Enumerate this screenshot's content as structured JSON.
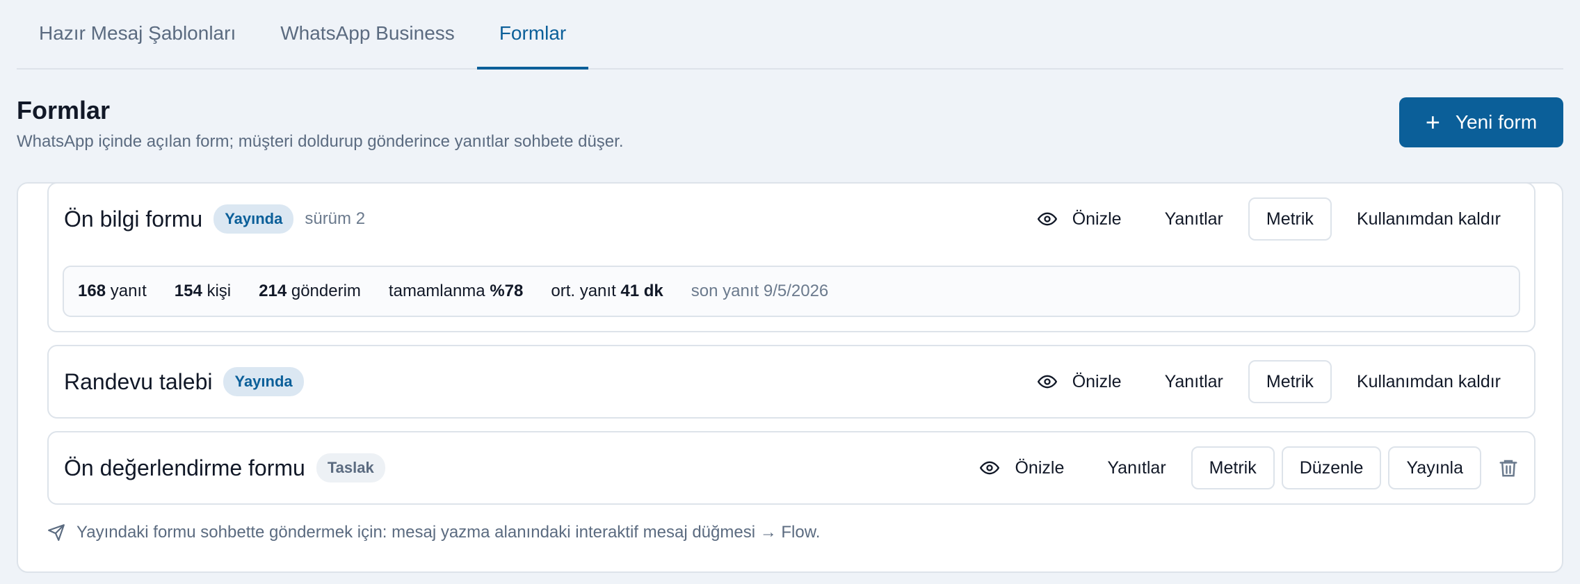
{
  "tabs": [
    {
      "label": "Hazır Mesaj Şablonları",
      "active": false
    },
    {
      "label": "WhatsApp Business",
      "active": false
    },
    {
      "label": "Formlar",
      "active": true
    }
  ],
  "header": {
    "title": "Formlar",
    "subtitle": "WhatsApp içinde açılan form; müşteri doldurup gönderince yanıtlar sohbete düşer.",
    "new_button": {
      "icon": "plus-icon",
      "label": "Yeni form"
    }
  },
  "forms": [
    {
      "title": "Ön bilgi formu",
      "status": "Yayında",
      "version": "sürüm 2",
      "actions": {
        "preview": "Önizle",
        "responses": "Yanıtlar",
        "metrics": "Metrik",
        "retire": "Kullanımdan kaldır"
      },
      "stats": {
        "responses_value": "168",
        "responses_label": "yanıt",
        "people_value": "154",
        "people_label": "kişi",
        "sends_value": "214",
        "sends_label": "gönderim",
        "completion_label": "tamamlanma",
        "completion_value": "%78",
        "avg_label": "ort. yanıt",
        "avg_value": "41 dk",
        "last_response": "son yanıt 9/5/2026"
      }
    },
    {
      "title": "Randevu talebi",
      "status": "Yayında",
      "actions": {
        "preview": "Önizle",
        "responses": "Yanıtlar",
        "metrics": "Metrik",
        "retire": "Kullanımdan kaldır"
      }
    },
    {
      "title": "Ön değerlendirme formu",
      "status": "Taslak",
      "actions": {
        "preview": "Önizle",
        "responses": "Yanıtlar",
        "metrics": "Metrik",
        "edit": "Düzenle",
        "publish": "Yayınla",
        "delete_icon": "trash-icon"
      }
    }
  ],
  "footnote": {
    "icon": "send-icon",
    "text": "Yayındaki formu sohbette göndermek için: mesaj yazma alanındaki interaktif mesaj düğmesi → Flow."
  },
  "colors": {
    "accent": "#0b5f99",
    "background": "#eff3f8",
    "border": "#dde3ea",
    "muted_text": "#5b6b80"
  }
}
